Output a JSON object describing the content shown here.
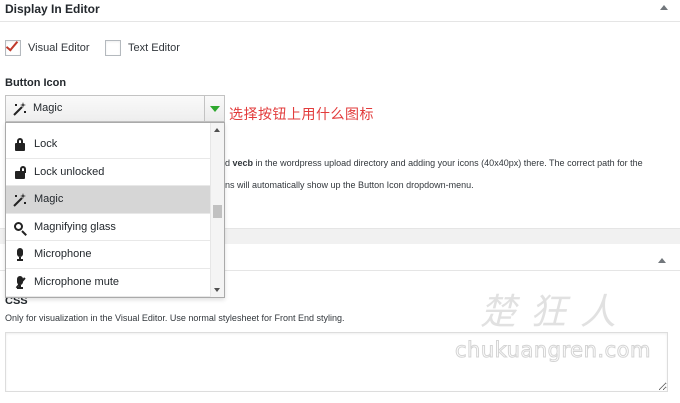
{
  "panel": {
    "title": "Display In Editor"
  },
  "editor_options": {
    "visual_label": "Visual Editor",
    "visual_checked": true,
    "text_label": "Text Editor",
    "text_checked": false
  },
  "button_icon": {
    "label": "Button Icon",
    "selected_value": "Magic",
    "selected_icon": "magic-wand-icon",
    "annotation": "选择按钮上用什么图标",
    "options": [
      {
        "label": "Lock",
        "icon": "lock-icon"
      },
      {
        "label": "Lock unlocked",
        "icon": "lock-unlocked-icon"
      },
      {
        "label": "Magic",
        "icon": "magic-wand-icon",
        "selected": true
      },
      {
        "label": "Magnifying glass",
        "icon": "magnifying-glass-icon"
      },
      {
        "label": "Microphone",
        "icon": "microphone-icon"
      },
      {
        "label": "Microphone mute",
        "icon": "microphone-mute-icon"
      }
    ]
  },
  "description": {
    "line1_prefix": "d",
    "line1_bold": "vecb",
    "line1_rest": " in the wordpress upload directory and adding your icons (40x40px) there. The correct path for the",
    "line2": "ns will automatically show up the Button Icon dropdown-menu."
  },
  "css_section": {
    "label": "CSS",
    "help": "Only for visualization in the Visual Editor. Use normal stylesheet for Front End styling.",
    "value": ""
  },
  "watermark": {
    "cn": "楚狂人",
    "en": "chukuangren.com"
  },
  "colors": {
    "check": "#c0392b",
    "dropdown_arrow": "#2ea82e",
    "annotation": "#e23b3b",
    "selected_row": "#d6d6d6"
  }
}
